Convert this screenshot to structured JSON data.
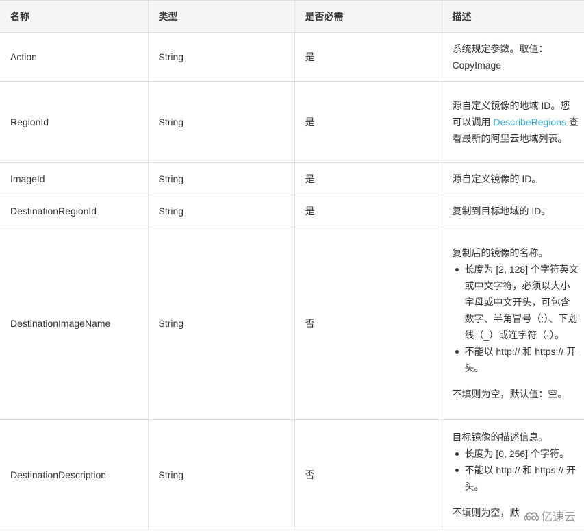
{
  "table": {
    "headers": {
      "name": "名称",
      "type": "类型",
      "required": "是否必需",
      "description": "描述"
    },
    "rows": [
      {
        "name": "Action",
        "type": "String",
        "required": "是",
        "description": {
          "line1": "系统规定参数。取值：",
          "line2": "CopyImage"
        }
      },
      {
        "name": "RegionId",
        "type": "String",
        "required": "是",
        "description": {
          "before_link": "源自定义镜像的地域 ID。您可以调用 ",
          "link_text": "DescribeRegions",
          "after_link": " 查看最新的阿里云地域列表。"
        }
      },
      {
        "name": "ImageId",
        "type": "String",
        "required": "是",
        "description": "源自定义镜像的 ID。"
      },
      {
        "name": "DestinationRegionId",
        "type": "String",
        "required": "是",
        "description": "复制到目标地域的 ID。"
      },
      {
        "name": "DestinationImageName",
        "type": "String",
        "required": "否",
        "description": {
          "intro": "复制后的镜像的名称。",
          "bullets": [
            "长度为 [2, 128] 个字符英文或中文字符，必须以大小字母或中文开头，可包含数字、半角冒号（:）、下划线（_）或连字符（-）。",
            "不能以 http:// 和 https:// 开头。"
          ],
          "footer": "不填则为空，默认值：空。"
        }
      },
      {
        "name": "DestinationDescription",
        "type": "String",
        "required": "否",
        "description": {
          "intro": "目标镜像的描述信息。",
          "bullets": [
            "长度为 [0, 256] 个字符。",
            "不能以 http:// 和 https:// 开头。"
          ],
          "footer": "不填则为空，默认值：空。"
        }
      }
    ]
  },
  "watermark": {
    "icon": "cloud-logo-icon",
    "text": "亿速云"
  }
}
